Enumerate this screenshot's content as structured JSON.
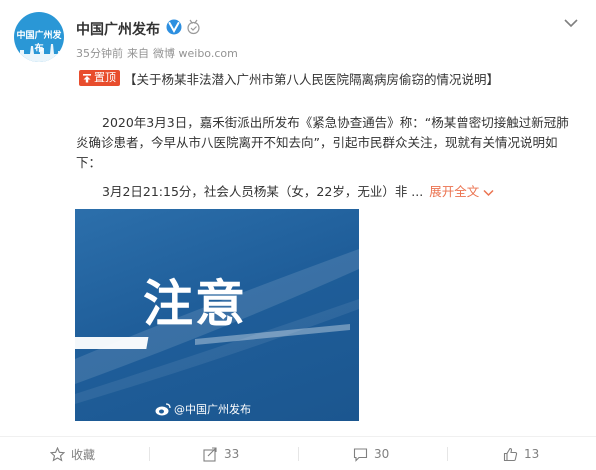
{
  "post": {
    "author": {
      "name": "中国广州发布",
      "avatar_text": "中国广州发布"
    },
    "meta": {
      "time": "35分钟前",
      "source_prefix": "来自",
      "source": "微博 weibo.com"
    },
    "pinned_label": "置顶",
    "headline": "【关于杨某非法潜入广州市第八人民医院隔离病房偷窃的情况说明】",
    "paragraph1": "2020年3月3日，嘉禾街派出所发布《紧急协查通告》称：“杨某曾密切接触过新冠肺炎确诊患者，今早从市八医院离开不知去向”，引起市民群众关注，现就有关情况说明如下：",
    "paragraph2": "3月2日21:15分，社会人员杨某（女，22岁，无业）非 ...",
    "expand_label": "展开全文",
    "image": {
      "title": "注意",
      "watermark": "@中国广州发布"
    }
  },
  "actions": {
    "favorite": {
      "label": "收藏"
    },
    "repost": {
      "count": "33"
    },
    "comment": {
      "count": "30"
    },
    "like": {
      "count": "13"
    }
  },
  "colors": {
    "pin_badge": "#e84d2d",
    "expand_link": "#eb7350",
    "image_bg": "#1f5e9a",
    "avatar_bg": "#2a97d6"
  },
  "icons": [
    "verified-icon",
    "medal-icon",
    "more-chevron-icon",
    "pin-icon",
    "chevron-down-icon",
    "weibo-icon",
    "star-icon",
    "repost-icon",
    "comment-icon",
    "like-icon"
  ]
}
